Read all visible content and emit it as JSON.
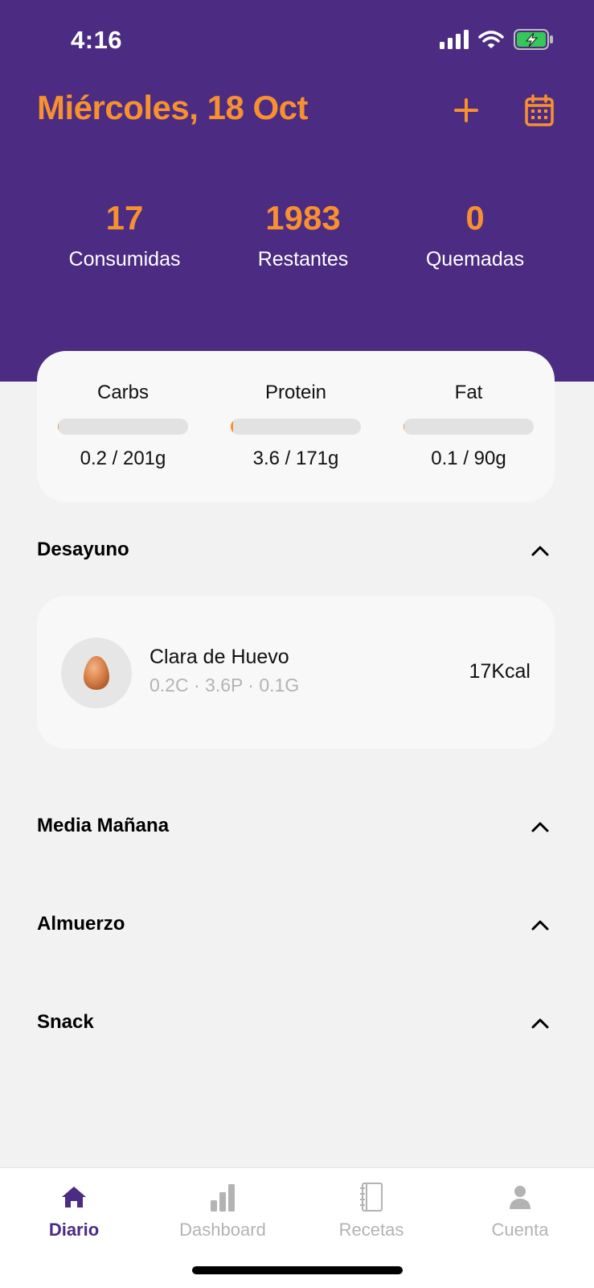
{
  "status_bar": {
    "time": "4:16"
  },
  "header": {
    "date": "Miércoles, 18 Oct",
    "stats": [
      {
        "value": "17",
        "label": "Consumidas"
      },
      {
        "value": "1983",
        "label": "Restantes"
      },
      {
        "value": "0",
        "label": "Quemadas"
      }
    ]
  },
  "macros": [
    {
      "name": "Carbs",
      "value": "0.2 / 201g",
      "progress": 0.001
    },
    {
      "name": "Protein",
      "value": "3.6 / 171g",
      "progress": 0.021
    },
    {
      "name": "Fat",
      "value": "0.1 / 90g",
      "progress": 0.001
    }
  ],
  "meals": [
    {
      "title": "Desayuno",
      "items": [
        {
          "name": "Clara de Huevo",
          "macros": "0.2C · 3.6P · 0.1G",
          "kcal": "17Kcal",
          "icon": "egg-icon"
        }
      ]
    },
    {
      "title": "Media Mañana",
      "items": []
    },
    {
      "title": "Almuerzo",
      "items": []
    },
    {
      "title": "Snack",
      "items": []
    }
  ],
  "tabs": [
    {
      "label": "Diario",
      "icon": "home-icon",
      "active": true
    },
    {
      "label": "Dashboard",
      "icon": "bar-chart-icon",
      "active": false
    },
    {
      "label": "Recetas",
      "icon": "notebook-icon",
      "active": false
    },
    {
      "label": "Cuenta",
      "icon": "person-icon",
      "active": false
    }
  ],
  "colors": {
    "header_bg": "#4b2c82",
    "accent": "#f7902f",
    "page_bg": "#f2f2f2",
    "card_bg": "#f8f8f8",
    "tab_active": "#4b2c82",
    "tab_inactive": "#b3b3b3",
    "battery_green": "#35c759"
  }
}
